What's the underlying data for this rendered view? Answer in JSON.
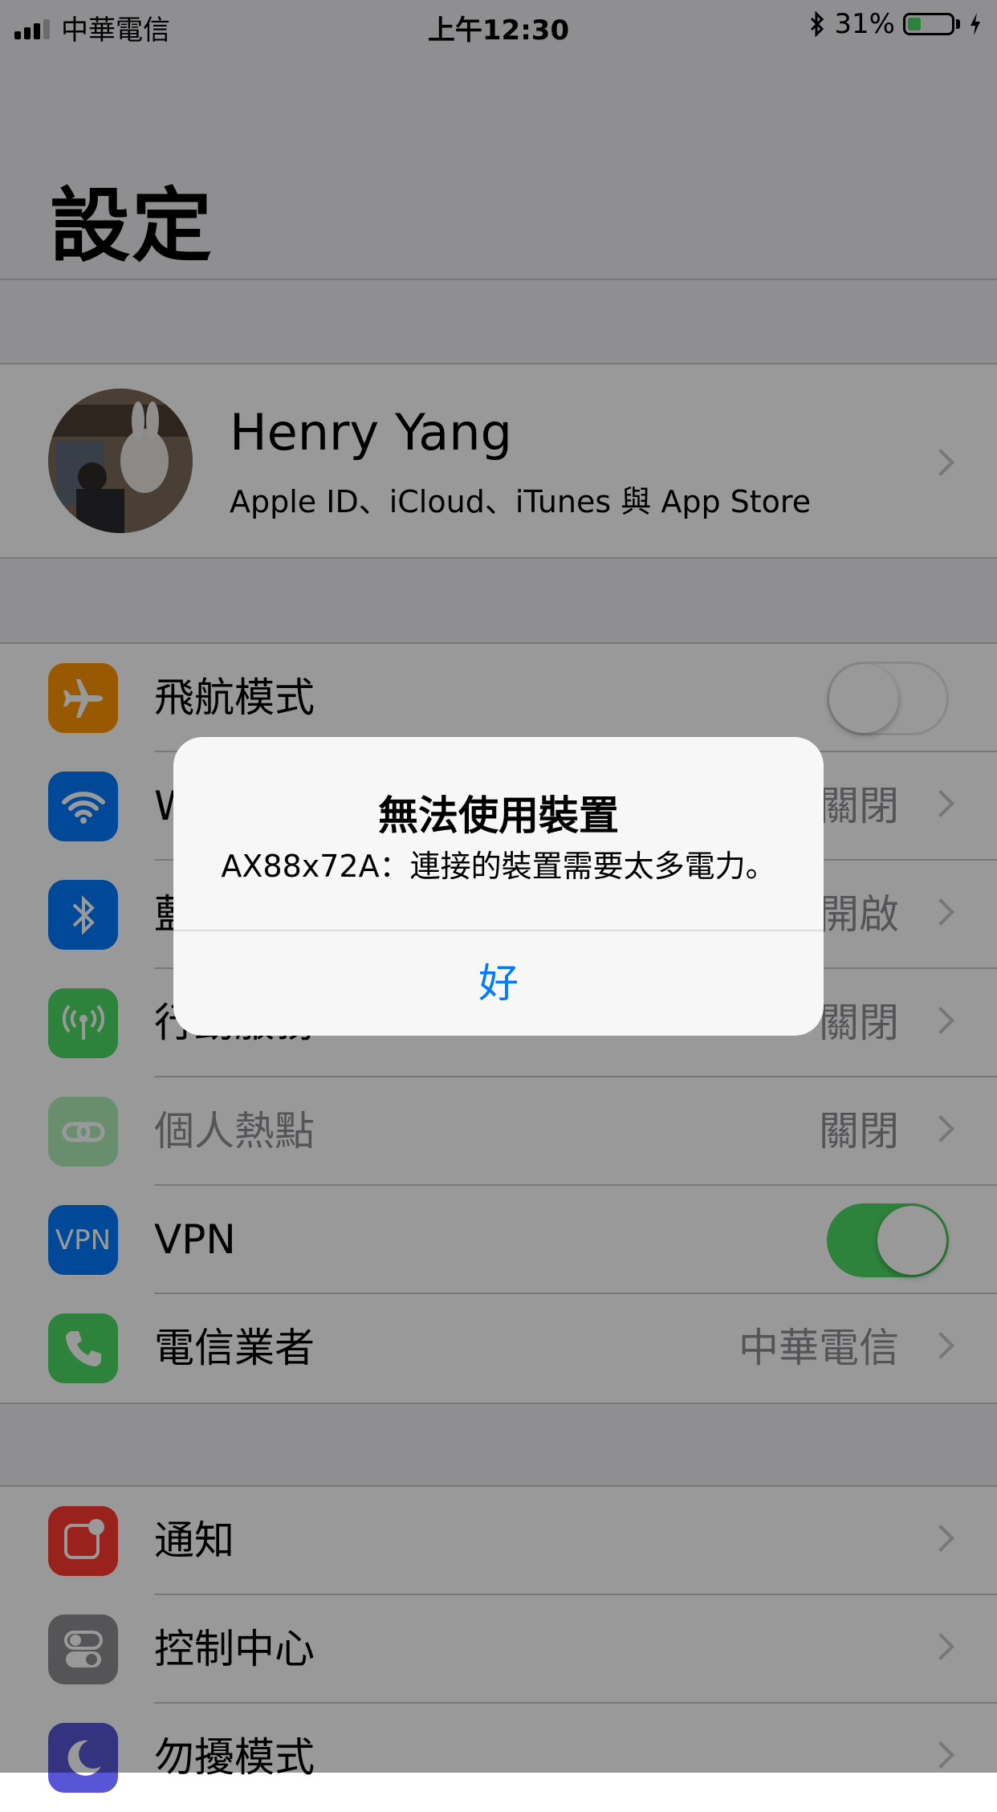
{
  "status_bar": {
    "carrier": "中華電信",
    "time": "上午12:30",
    "battery_percent": "31%",
    "battery_level": 0.31
  },
  "title": "設定",
  "profile": {
    "name": "Henry Yang",
    "subtitle": "Apple ID、iCloud、iTunes 與 App Store"
  },
  "connectivity": [
    {
      "label": "飛航模式",
      "value": "",
      "icon": "airplane-icon",
      "color": "#ff9500",
      "control": "toggle",
      "on": false
    },
    {
      "label": "Wi-Fi",
      "value": "關閉",
      "icon": "wifi-icon",
      "color": "#007aff",
      "control": "chevron"
    },
    {
      "label": "藍牙",
      "value": "開啟",
      "icon": "bluetooth-icon",
      "color": "#007aff",
      "control": "chevron"
    },
    {
      "label": "行動服務",
      "value": "關閉",
      "icon": "cellular-icon",
      "color": "#4cd964",
      "control": "chevron"
    },
    {
      "label": "個人熱點",
      "value": "關閉",
      "icon": "hotspot-icon",
      "color": "#4cd964",
      "control": "chevron",
      "disabled": true
    },
    {
      "label": "VPN",
      "value": "",
      "icon": "vpn-icon",
      "color": "#007aff",
      "control": "toggle",
      "on": true,
      "icon_text": "VPN"
    },
    {
      "label": "電信業者",
      "value": "中華電信",
      "icon": "phone-icon",
      "color": "#4cd964",
      "control": "chevron"
    }
  ],
  "general": [
    {
      "label": "通知",
      "icon": "notifications-icon",
      "color": "#ff3b30"
    },
    {
      "label": "控制中心",
      "icon": "control-center-icon",
      "color": "#8e8e93"
    },
    {
      "label": "勿擾模式",
      "icon": "moon-icon",
      "color": "#5856d6"
    }
  ],
  "alert": {
    "title": "無法使用裝置",
    "message": "AX88x72A：連接的裝置需要太多電力。",
    "button": "好"
  }
}
